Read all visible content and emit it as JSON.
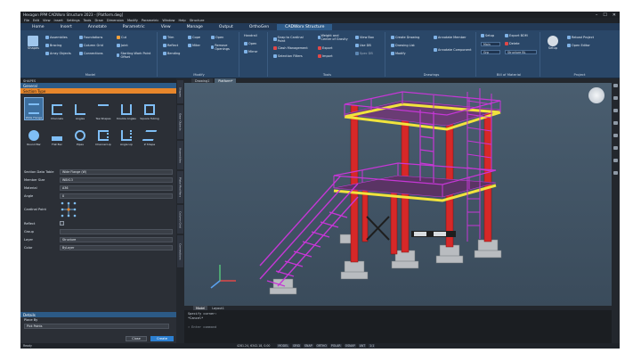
{
  "window": {
    "title": "Hexagon PPM CADWorx Structure 2023 - [Platform.dwg]",
    "controls": [
      "–",
      "☐",
      "✕"
    ]
  },
  "menu": [
    "File",
    "Edit",
    "View",
    "Insert",
    "Settings",
    "Tools",
    "Draw",
    "Dimension",
    "Modify",
    "Parametric",
    "Window",
    "Help",
    "Structure"
  ],
  "ribbon_tabs": [
    "Home",
    "Insert",
    "Annotate",
    "Parametric",
    "View",
    "Manage",
    "Output",
    "OrthoGen",
    "CADWorx Structure"
  ],
  "active_ribbon_tab": "CADWorx Structure",
  "ribbon": {
    "model": {
      "label": "Model",
      "shapes": "Shapes",
      "items": [
        "Assemblies",
        "Foundations",
        "Bracing",
        "Column Grid",
        "Array Objects",
        "Connections",
        "Cut",
        "Joint",
        "Starting Work Point Offset"
      ]
    },
    "modify": {
      "label": "Modify",
      "items": [
        "Trim",
        "Reflect",
        "Bending",
        "Cope",
        "Miter",
        "Open",
        "Remove Openings"
      ]
    },
    "handrail": {
      "label": "Handrail",
      "items": [
        "Open",
        "Mirror"
      ]
    },
    "tools": {
      "label": "Tools",
      "items": [
        "Snap to Cardinal Point",
        "Clash Management",
        "Selection Filters",
        "Weight and Center of Gravity",
        "Export",
        "Import",
        "View Box",
        "Use DB",
        "Spec DB"
      ]
    },
    "drawings": {
      "label": "Drawings",
      "items": [
        "Create Drawing",
        "Drawing List",
        "Modify",
        "Annotate Member",
        "Annotate Component"
      ]
    },
    "bom": {
      "label": "Bill of Material",
      "items": [
        "Setup",
        "Delete",
        "Export BOM"
      ],
      "combos": [
        "Main",
        "Grp",
        "Structure BL"
      ]
    },
    "project": {
      "label": "Project",
      "items": [
        "Setup",
        "Reload Project",
        "Open Editor"
      ]
    }
  },
  "left_panel": {
    "header": "SHAPES",
    "general": "General",
    "section_type_title": "Section Type",
    "sections": [
      "Wide Flange",
      "Channels",
      "Angles",
      "Tee Shapes",
      "Double Angles",
      "Square Tubing",
      "Round Bar",
      "Flat Bar",
      "Pipes",
      "Channel Lip",
      "Angle Lip",
      "Z Shape"
    ],
    "selected_section": "Wide Flange",
    "props": [
      {
        "label": "Section Data Table",
        "value": "Wide Flange (W)"
      },
      {
        "label": "Member Size",
        "value": "W8X13"
      },
      {
        "label": "Material",
        "value": "A36"
      },
      {
        "label": "Angle",
        "value": "0"
      }
    ],
    "cardinal_label": "Cardinal Point",
    "reflect_label": "Reflect",
    "group": {
      "label": "Group",
      "value": ""
    },
    "layer": {
      "label": "Layer",
      "value": "Structure"
    },
    "color": {
      "label": "Color",
      "value": "ByLayer"
    },
    "details_title": "Details",
    "place_by_label": "Place By",
    "place_by_value": "Pick Points",
    "close_btn": "Close",
    "create_btn": "Create"
  },
  "side_tabs": [
    "Shapes",
    "Gear Objects",
    "Assemblies",
    "Plate Modifiers",
    "Column Grid",
    "Connections"
  ],
  "viewport": {
    "tabs": [
      "Drawing1",
      "Platform*"
    ],
    "active_tab": "Platform*"
  },
  "layout_tabs": [
    "Model",
    "Layout1"
  ],
  "active_layout": "Model",
  "command": {
    "lines": [
      "Specify corner:",
      "*Cancel*",
      ""
    ],
    "prompt": "Enter command"
  },
  "status": {
    "left": "Ready",
    "coords": "4281.24, 6342.18, 0.00",
    "toggles": [
      "MODEL",
      "GRID",
      "SNAP",
      "ORTHO",
      "POLAR",
      "OSNAP",
      "LWT"
    ],
    "zoom": "1:1"
  },
  "colors": {
    "ribbon": "#2a4768",
    "accent_orange": "#e7862b",
    "structure_red": "#d62828",
    "handrail_magenta": "#c637d6",
    "toe_yellow": "#f1e33c"
  }
}
